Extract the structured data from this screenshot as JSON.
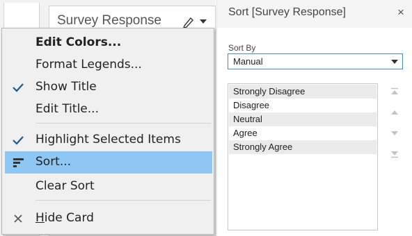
{
  "card": {
    "title": "Survey Response",
    "tools": [
      "pencil-icon",
      "chevron-down-icon"
    ]
  },
  "menu": {
    "items": [
      {
        "label": "Edit Colors...",
        "bold": true,
        "checked": false
      },
      {
        "label": "Format Legends...",
        "checked": false
      },
      {
        "label": "Show Title",
        "checked": true
      },
      {
        "label": "Edit Title...",
        "checked": false
      },
      {
        "label": "Highlight Selected Items",
        "checked": true
      },
      {
        "label": "Sort...",
        "icon": "sort-icon",
        "highlighted": true
      },
      {
        "label": "Clear Sort",
        "checked": false
      },
      {
        "label_prefix": "H",
        "label_rest": "ide Card",
        "icon": "close-icon"
      }
    ]
  },
  "sort_panel": {
    "title": "Sort [Survey Response]",
    "close_icon": "×",
    "sort_by_label": "Sort By",
    "sort_by_value": "Manual",
    "items": [
      "Strongly Disagree",
      "Disagree",
      "Neutral",
      "Agree",
      "Strongly Agree"
    ],
    "arrow_icons": [
      "move-to-top-icon",
      "move-up-icon",
      "move-down-icon",
      "move-to-bottom-icon"
    ]
  },
  "colors": {
    "highlight": "#8ec7f3",
    "check": "#1e5a8c",
    "select_border": "#4a88c7"
  }
}
